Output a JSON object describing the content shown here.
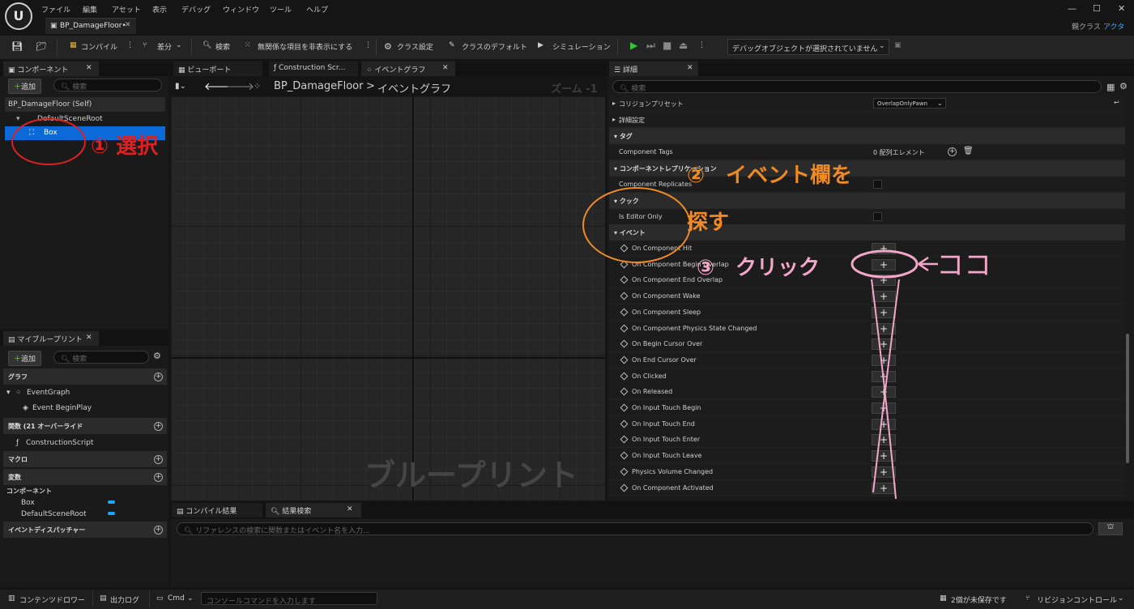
{
  "app": {
    "logo": "U",
    "menu": [
      "ファイル",
      "編集",
      "アセット",
      "表示",
      "デバッグ",
      "ウィンドウ",
      "ツール",
      "ヘルプ"
    ],
    "window_controls": [
      "—",
      "☐",
      "✕"
    ],
    "doc_tab": "BP_DamageFloor•",
    "parent_class_label": "親クラス",
    "parent_class_value": "アクタ"
  },
  "toolbar": {
    "compile": "コンパイル",
    "diff": "差分",
    "find": "検索",
    "hide_unrelated": "無関係な項目を非表示にする",
    "class_settings": "クラス設定",
    "class_defaults": "クラスのデフォルト",
    "simulation": "シミュレーション",
    "debug_object": "デバッグオブジェクトが選択されていません"
  },
  "components_panel": {
    "tab": "コンポーネント",
    "add": "追加",
    "search_placeholder": "検索",
    "tree": [
      "BP_DamageFloor (Self)",
      "DefaultSceneRoot",
      "Box"
    ]
  },
  "center_tabs": [
    "ビューポート",
    "Construction Scr...",
    "イベントグラフ"
  ],
  "breadcrumb": {
    "root": "BP_DamageFloor",
    "sep": ">",
    "current": "イベントグラフ"
  },
  "zoom_label": "ズーム -1",
  "graph_watermark": "ブループリント",
  "myblueprint_panel": {
    "tab": "マイブループリント",
    "add": "追加",
    "search_placeholder": "検索",
    "graph_section": "グラフ",
    "event_graph": "EventGraph",
    "event_begin_play": "Event BeginPlay",
    "functions_section": "関数 (21 オーバーライド",
    "construction_script": "ConstructionScript",
    "macro_section": "マクロ",
    "variables_section": "変数",
    "components_sub": "コンポーネント",
    "var_box": "Box",
    "var_root": "DefaultSceneRoot",
    "dispatchers_section": "イベントディスパッチャー"
  },
  "details_panel": {
    "tab": "詳細",
    "search_placeholder": "検索",
    "collision_preset_label": "コリジョンプリセット",
    "collision_preset_value": "OverlapOnlyPawn",
    "advanced": "詳細設定",
    "tags_section": "タグ",
    "component_tags_label": "Component Tags",
    "component_tags_value": "0 配列エレメント",
    "replication_section": "コンポーネントレプリケーション",
    "component_replicates": "Component Replicates",
    "cook_section": "クック",
    "is_editor_only": "Is Editor Only",
    "events_section": "イベント",
    "events": [
      "On Component Hit",
      "On Component Begin Overlap",
      "On Component End Overlap",
      "On Component Wake",
      "On Component Sleep",
      "On Component Physics State Changed",
      "On Begin Cursor Over",
      "On End Cursor Over",
      "On Clicked",
      "On Released",
      "On Input Touch Begin",
      "On Input Touch End",
      "On Input Touch Enter",
      "On Input Touch Leave",
      "Physics Volume Changed",
      "On Component Activated"
    ],
    "add_symbol": "+"
  },
  "bottom_panel": {
    "tabs": [
      "コンパイル結果",
      "結果検索"
    ],
    "search_placeholder": "リファレンスの検索に関数またはイベント名を入力..."
  },
  "statusbar": {
    "content_drawer": "コンテンツドロワー",
    "output_log": "出力ログ",
    "cmd": "Cmd",
    "console_placeholder": "コンソールコマンドを入力します",
    "unsaved": "2個が未保存です",
    "revision_control": "リビジョンコントロール"
  },
  "annotations": {
    "step1": "① 選択",
    "step2": "②　イベント欄を",
    "step2b": "探す",
    "step3": "③　クリック",
    "koko": "ココ"
  },
  "colors": {
    "selection_blue": "#0b6ad8",
    "annotation_red": "#e02020",
    "annotation_orange": "#f08a24",
    "annotation_pink": "#f4a6c8",
    "play_green": "#36c43a"
  }
}
